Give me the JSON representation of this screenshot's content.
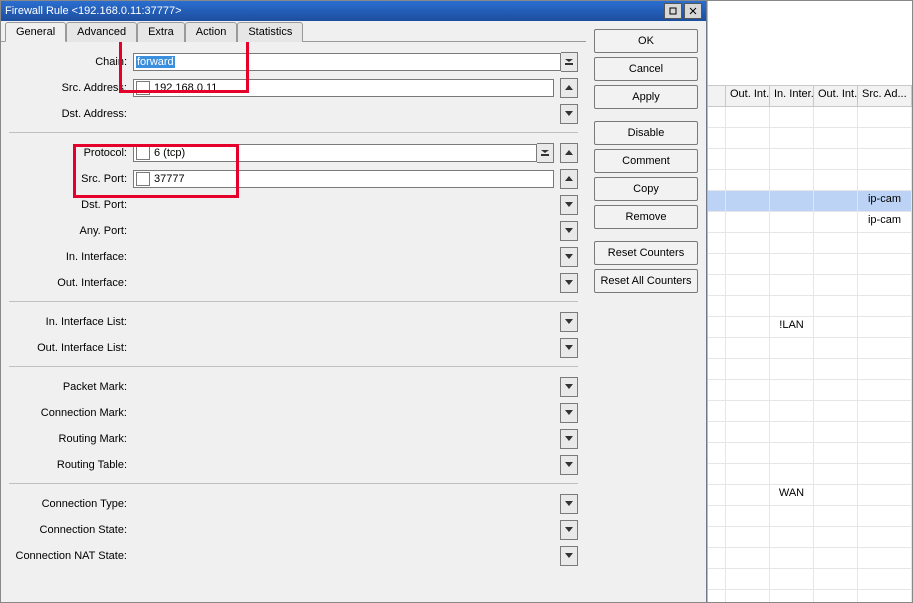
{
  "window": {
    "title": "Firewall Rule <192.168.0.11:37777>"
  },
  "tabs": [
    "General",
    "Advanced",
    "Extra",
    "Action",
    "Statistics"
  ],
  "active_tab": "General",
  "labels": {
    "chain": "Chain:",
    "src_addr": "Src. Address:",
    "dst_addr": "Dst. Address:",
    "protocol": "Protocol:",
    "src_port": "Src. Port:",
    "dst_port": "Dst. Port:",
    "any_port": "Any. Port:",
    "in_if": "In. Interface:",
    "out_if": "Out. Interface:",
    "in_ifl": "In. Interface List:",
    "out_ifl": "Out. Interface List:",
    "pkt_mark": "Packet Mark:",
    "conn_mark": "Connection Mark:",
    "route_mark": "Routing Mark:",
    "route_table": "Routing Table:",
    "conn_type": "Connection Type:",
    "conn_state": "Connection State:",
    "conn_nat": "Connection NAT State:"
  },
  "values": {
    "chain": "forward",
    "src_addr": "192.168.0.11",
    "protocol": "6 (tcp)",
    "src_port": "37777"
  },
  "buttons": {
    "ok": "OK",
    "cancel": "Cancel",
    "apply": "Apply",
    "disable": "Disable",
    "comment": "Comment",
    "copy": "Copy",
    "remove": "Remove",
    "reset": "Reset Counters",
    "reset_all": "Reset All Counters"
  },
  "grid": {
    "headers": [
      "Out. Int...",
      "In. Inter...",
      "Out. Int...",
      "Src. Ad..."
    ],
    "rows": [
      {
        "c": [
          "",
          "",
          "",
          "",
          ""
        ]
      },
      {
        "c": [
          "",
          "",
          "",
          "",
          ""
        ]
      },
      {
        "c": [
          "",
          "",
          "",
          "",
          ""
        ]
      },
      {
        "c": [
          "",
          "",
          "",
          "",
          ""
        ]
      },
      {
        "c": [
          "",
          "",
          "",
          "",
          "ip-cam"
        ],
        "hl": true
      },
      {
        "c": [
          "",
          "",
          "",
          "",
          "ip-cam"
        ]
      },
      {
        "c": [
          "",
          "",
          "",
          "",
          ""
        ]
      },
      {
        "c": [
          "",
          "",
          "",
          "",
          ""
        ]
      },
      {
        "c": [
          "",
          "",
          "",
          "",
          ""
        ]
      },
      {
        "c": [
          "",
          "",
          "",
          "",
          ""
        ]
      },
      {
        "c": [
          "",
          "",
          "!LAN",
          "",
          ""
        ]
      },
      {
        "c": [
          "",
          "",
          "",
          "",
          ""
        ]
      },
      {
        "c": [
          "",
          "",
          "",
          "",
          ""
        ]
      },
      {
        "c": [
          "",
          "",
          "",
          "",
          ""
        ]
      },
      {
        "c": [
          "",
          "",
          "",
          "",
          ""
        ]
      },
      {
        "c": [
          "",
          "",
          "",
          "",
          ""
        ]
      },
      {
        "c": [
          "",
          "",
          "",
          "",
          ""
        ]
      },
      {
        "c": [
          "",
          "",
          "",
          "",
          ""
        ]
      },
      {
        "c": [
          "",
          "",
          "WAN",
          "",
          ""
        ]
      },
      {
        "c": [
          "",
          "",
          "",
          "",
          ""
        ]
      },
      {
        "c": [
          "",
          "",
          "",
          "",
          ""
        ]
      },
      {
        "c": [
          "",
          "",
          "",
          "",
          ""
        ]
      },
      {
        "c": [
          "",
          "",
          "",
          "",
          ""
        ]
      },
      {
        "c": [
          "",
          "",
          "",
          "",
          ""
        ]
      }
    ]
  }
}
